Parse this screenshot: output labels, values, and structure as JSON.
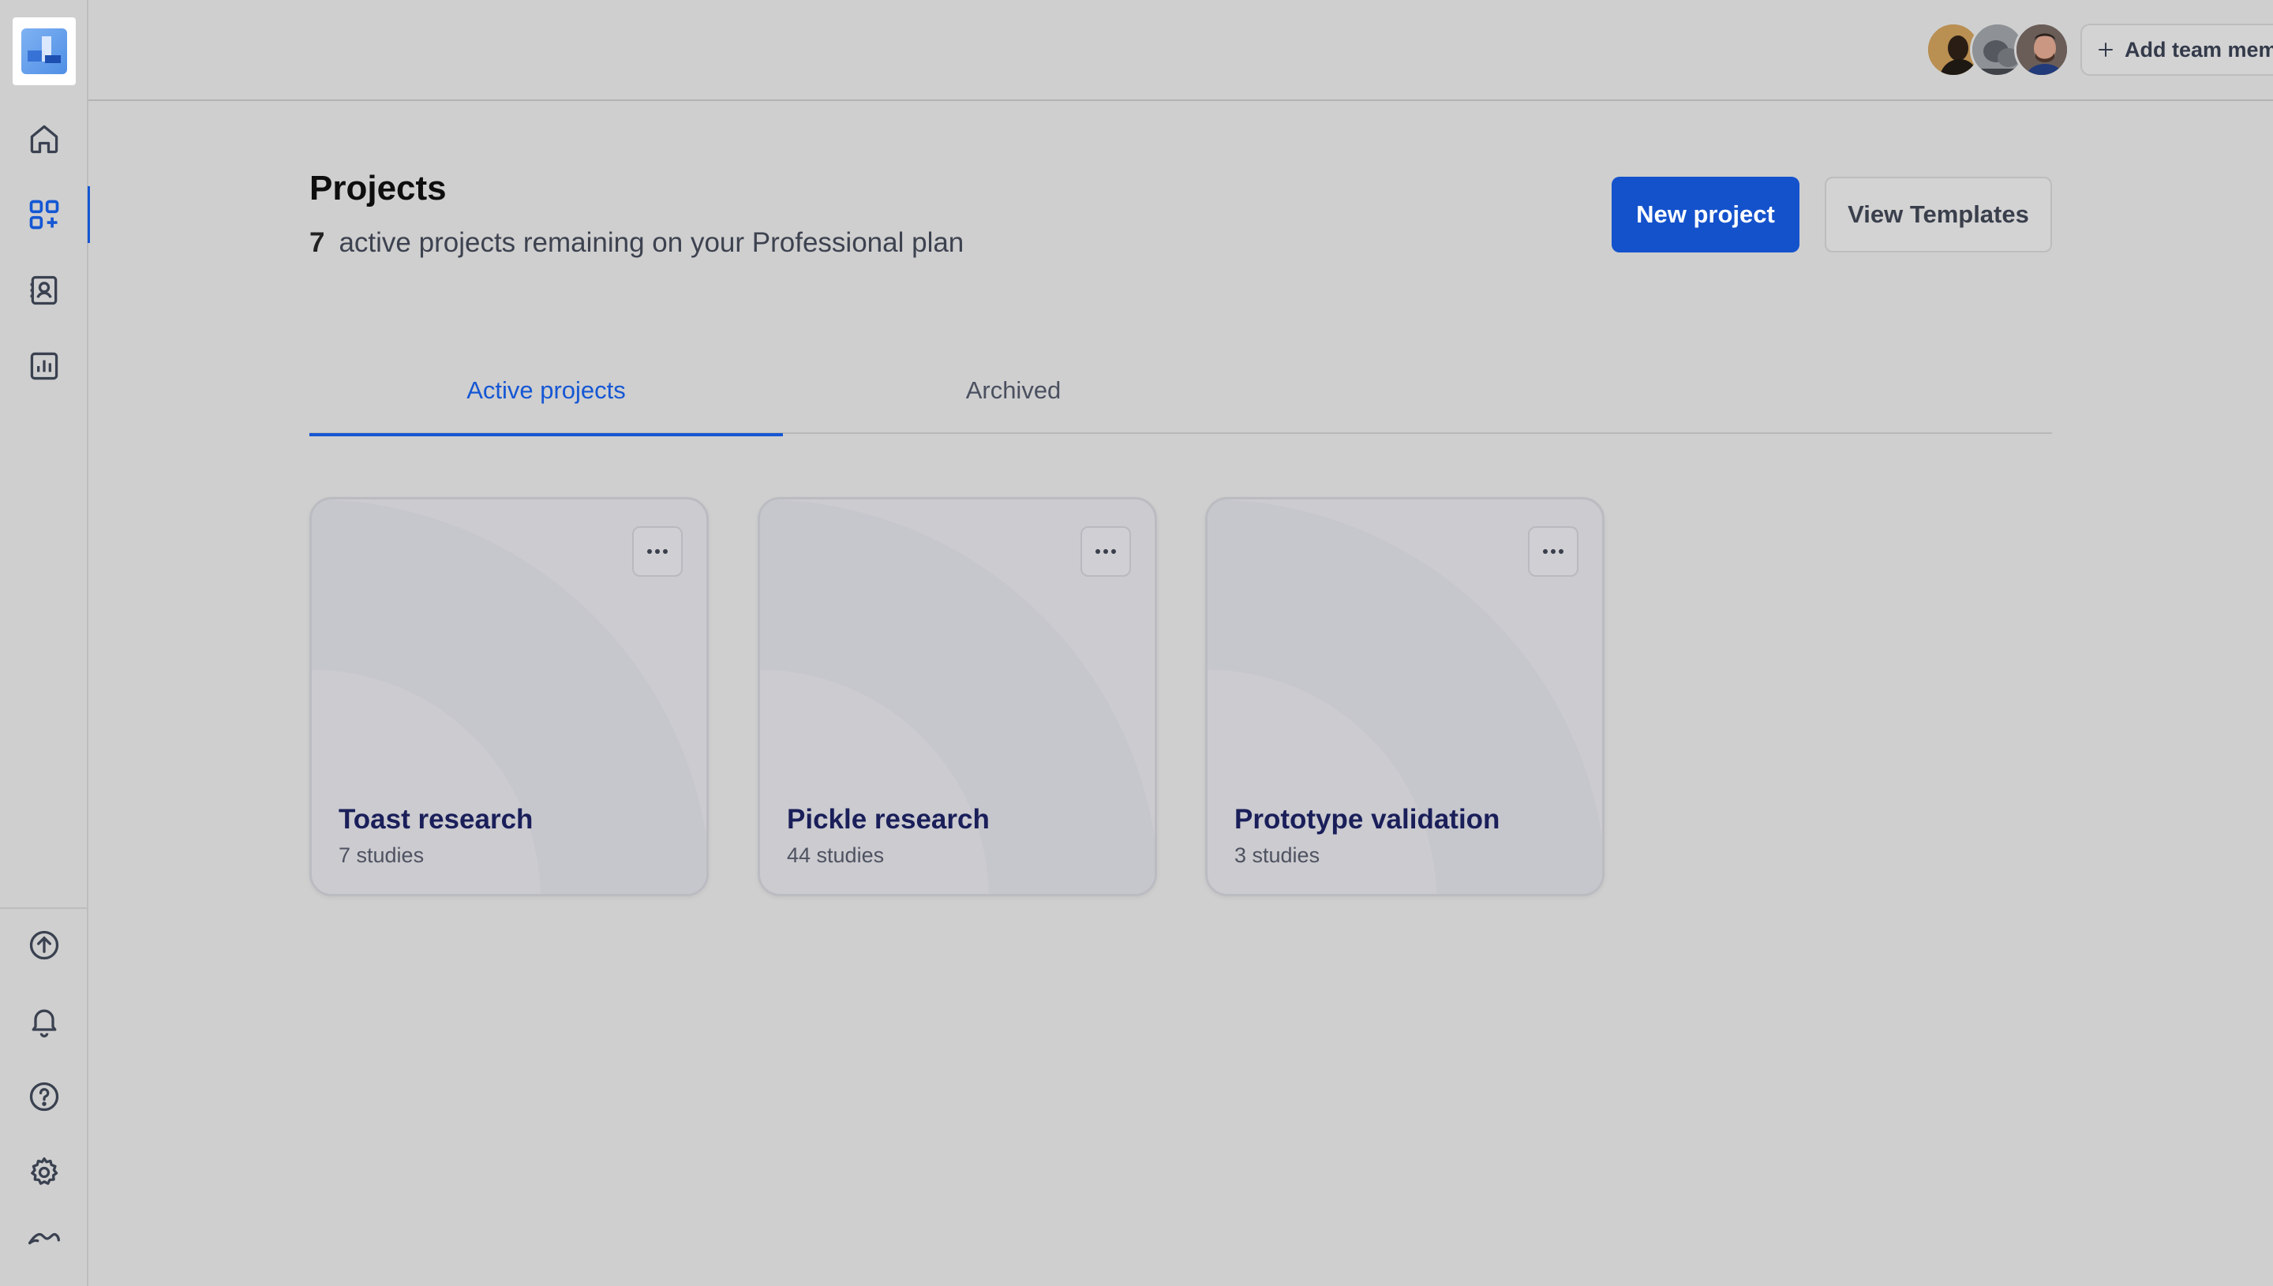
{
  "colors": {
    "accent": "#1452cc",
    "background": "#cfcfcf",
    "card_title": "#1a1f5a"
  },
  "sidebar": {
    "items": [
      {
        "name": "home",
        "icon": "home-icon"
      },
      {
        "name": "projects",
        "icon": "grid-icon",
        "active": true
      },
      {
        "name": "contacts",
        "icon": "contact-book-icon"
      },
      {
        "name": "reports",
        "icon": "bar-chart-icon"
      }
    ],
    "bottom_items": [
      {
        "name": "upload",
        "icon": "upload-circle-icon"
      },
      {
        "name": "notifications",
        "icon": "bell-icon"
      },
      {
        "name": "help",
        "icon": "help-circle-icon"
      },
      {
        "name": "settings",
        "icon": "gear-icon"
      },
      {
        "name": "brand",
        "icon": "brand-wave-icon"
      }
    ]
  },
  "header": {
    "add_members_label": "Add team members"
  },
  "page": {
    "title": "Projects",
    "remaining_count": "7",
    "remaining_text": "active projects remaining on your Professional plan",
    "new_project_label": "New project",
    "view_templates_label": "View Templates"
  },
  "tabs": [
    {
      "label": "Active projects",
      "active": true
    },
    {
      "label": "Archived",
      "active": false
    }
  ],
  "projects": [
    {
      "title": "Toast research",
      "meta": "7 studies"
    },
    {
      "title": "Pickle research",
      "meta": "44 studies"
    },
    {
      "title": "Prototype validation",
      "meta": "3 studies"
    }
  ]
}
